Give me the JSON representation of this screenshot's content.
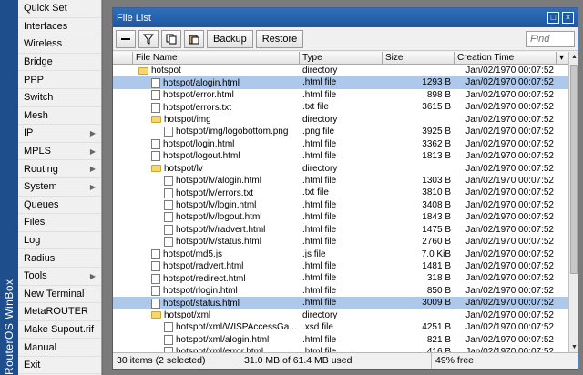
{
  "brand_text": "RouterOS WinBox",
  "sidebar": {
    "items": [
      {
        "label": "Quick Set",
        "arrow": false
      },
      {
        "label": "Interfaces",
        "arrow": false
      },
      {
        "label": "Wireless",
        "arrow": false
      },
      {
        "label": "Bridge",
        "arrow": false
      },
      {
        "label": "PPP",
        "arrow": false
      },
      {
        "label": "Switch",
        "arrow": false
      },
      {
        "label": "Mesh",
        "arrow": false
      },
      {
        "label": "IP",
        "arrow": true
      },
      {
        "label": "MPLS",
        "arrow": true
      },
      {
        "label": "Routing",
        "arrow": true
      },
      {
        "label": "System",
        "arrow": true
      },
      {
        "label": "Queues",
        "arrow": false
      },
      {
        "label": "Files",
        "arrow": false
      },
      {
        "label": "Log",
        "arrow": false
      },
      {
        "label": "Radius",
        "arrow": false
      },
      {
        "label": "Tools",
        "arrow": true
      },
      {
        "label": "New Terminal",
        "arrow": false
      },
      {
        "label": "MetaROUTER",
        "arrow": false
      },
      {
        "label": "Make Supout.rif",
        "arrow": false
      },
      {
        "label": "Manual",
        "arrow": false
      },
      {
        "label": "Exit",
        "arrow": false
      }
    ]
  },
  "window": {
    "title": "File List",
    "toolbar": {
      "backup_label": "Backup",
      "restore_label": "Restore",
      "find_placeholder": "Find"
    },
    "columns": [
      "File Name",
      "Type",
      "Size",
      "Creation Time"
    ],
    "rows": [
      {
        "name": "hotspot",
        "type": "directory",
        "size": "",
        "time": "Jan/02/1970 00:07:52",
        "icon": "folder",
        "indent": 0,
        "selected": false
      },
      {
        "name": "hotspot/alogin.html",
        "type": ".html file",
        "size": "1293 B",
        "time": "Jan/02/1970 00:07:52",
        "icon": "file",
        "indent": 1,
        "selected": true
      },
      {
        "name": "hotspot/error.html",
        "type": ".html file",
        "size": "898 B",
        "time": "Jan/02/1970 00:07:52",
        "icon": "file",
        "indent": 1,
        "selected": false
      },
      {
        "name": "hotspot/errors.txt",
        "type": ".txt file",
        "size": "3615 B",
        "time": "Jan/02/1970 00:07:52",
        "icon": "file",
        "indent": 1,
        "selected": false
      },
      {
        "name": "hotspot/img",
        "type": "directory",
        "size": "",
        "time": "Jan/02/1970 00:07:52",
        "icon": "folder",
        "indent": 1,
        "selected": false
      },
      {
        "name": "hotspot/img/logobottom.png",
        "type": ".png file",
        "size": "3925 B",
        "time": "Jan/02/1970 00:07:52",
        "icon": "file",
        "indent": 2,
        "selected": false
      },
      {
        "name": "hotspot/login.html",
        "type": ".html file",
        "size": "3362 B",
        "time": "Jan/02/1970 00:07:52",
        "icon": "file",
        "indent": 1,
        "selected": false
      },
      {
        "name": "hotspot/logout.html",
        "type": ".html file",
        "size": "1813 B",
        "time": "Jan/02/1970 00:07:52",
        "icon": "file",
        "indent": 1,
        "selected": false
      },
      {
        "name": "hotspot/lv",
        "type": "directory",
        "size": "",
        "time": "Jan/02/1970 00:07:52",
        "icon": "folder",
        "indent": 1,
        "selected": false
      },
      {
        "name": "hotspot/lv/alogin.html",
        "type": ".html file",
        "size": "1303 B",
        "time": "Jan/02/1970 00:07:52",
        "icon": "file",
        "indent": 2,
        "selected": false
      },
      {
        "name": "hotspot/lv/errors.txt",
        "type": ".txt file",
        "size": "3810 B",
        "time": "Jan/02/1970 00:07:52",
        "icon": "file",
        "indent": 2,
        "selected": false
      },
      {
        "name": "hotspot/lv/login.html",
        "type": ".html file",
        "size": "3408 B",
        "time": "Jan/02/1970 00:07:52",
        "icon": "file",
        "indent": 2,
        "selected": false
      },
      {
        "name": "hotspot/lv/logout.html",
        "type": ".html file",
        "size": "1843 B",
        "time": "Jan/02/1970 00:07:52",
        "icon": "file",
        "indent": 2,
        "selected": false
      },
      {
        "name": "hotspot/lv/radvert.html",
        "type": ".html file",
        "size": "1475 B",
        "time": "Jan/02/1970 00:07:52",
        "icon": "file",
        "indent": 2,
        "selected": false
      },
      {
        "name": "hotspot/lv/status.html",
        "type": ".html file",
        "size": "2760 B",
        "time": "Jan/02/1970 00:07:52",
        "icon": "file",
        "indent": 2,
        "selected": false
      },
      {
        "name": "hotspot/md5.js",
        "type": ".js file",
        "size": "7.0 KiB",
        "time": "Jan/02/1970 00:07:52",
        "icon": "file",
        "indent": 1,
        "selected": false
      },
      {
        "name": "hotspot/radvert.html",
        "type": ".html file",
        "size": "1481 B",
        "time": "Jan/02/1970 00:07:52",
        "icon": "file",
        "indent": 1,
        "selected": false
      },
      {
        "name": "hotspot/redirect.html",
        "type": ".html file",
        "size": "318 B",
        "time": "Jan/02/1970 00:07:52",
        "icon": "file",
        "indent": 1,
        "selected": false
      },
      {
        "name": "hotspot/rlogin.html",
        "type": ".html file",
        "size": "850 B",
        "time": "Jan/02/1970 00:07:52",
        "icon": "file",
        "indent": 1,
        "selected": false
      },
      {
        "name": "hotspot/status.html",
        "type": ".html file",
        "size": "3009 B",
        "time": "Jan/02/1970 00:07:52",
        "icon": "file",
        "indent": 1,
        "selected": true
      },
      {
        "name": "hotspot/xml",
        "type": "directory",
        "size": "",
        "time": "Jan/02/1970 00:07:52",
        "icon": "folder",
        "indent": 1,
        "selected": false
      },
      {
        "name": "hotspot/xml/WISPAccessGa...",
        "type": ".xsd file",
        "size": "4251 B",
        "time": "Jan/02/1970 00:07:52",
        "icon": "file",
        "indent": 2,
        "selected": false
      },
      {
        "name": "hotspot/xml/alogin.html",
        "type": ".html file",
        "size": "821 B",
        "time": "Jan/02/1970 00:07:52",
        "icon": "file",
        "indent": 2,
        "selected": false
      },
      {
        "name": "hotspot/xml/error.html",
        "type": ".html file",
        "size": "416 B",
        "time": "Jan/02/1970 00:07:52",
        "icon": "file",
        "indent": 2,
        "selected": false
      }
    ],
    "status": {
      "count": "30 items (2 selected)",
      "usage": "31.0 MB of 61.4 MB used",
      "free": "49% free"
    }
  },
  "colors": {
    "selection": "#aec8ec",
    "titlebar": "#1f57a0"
  }
}
